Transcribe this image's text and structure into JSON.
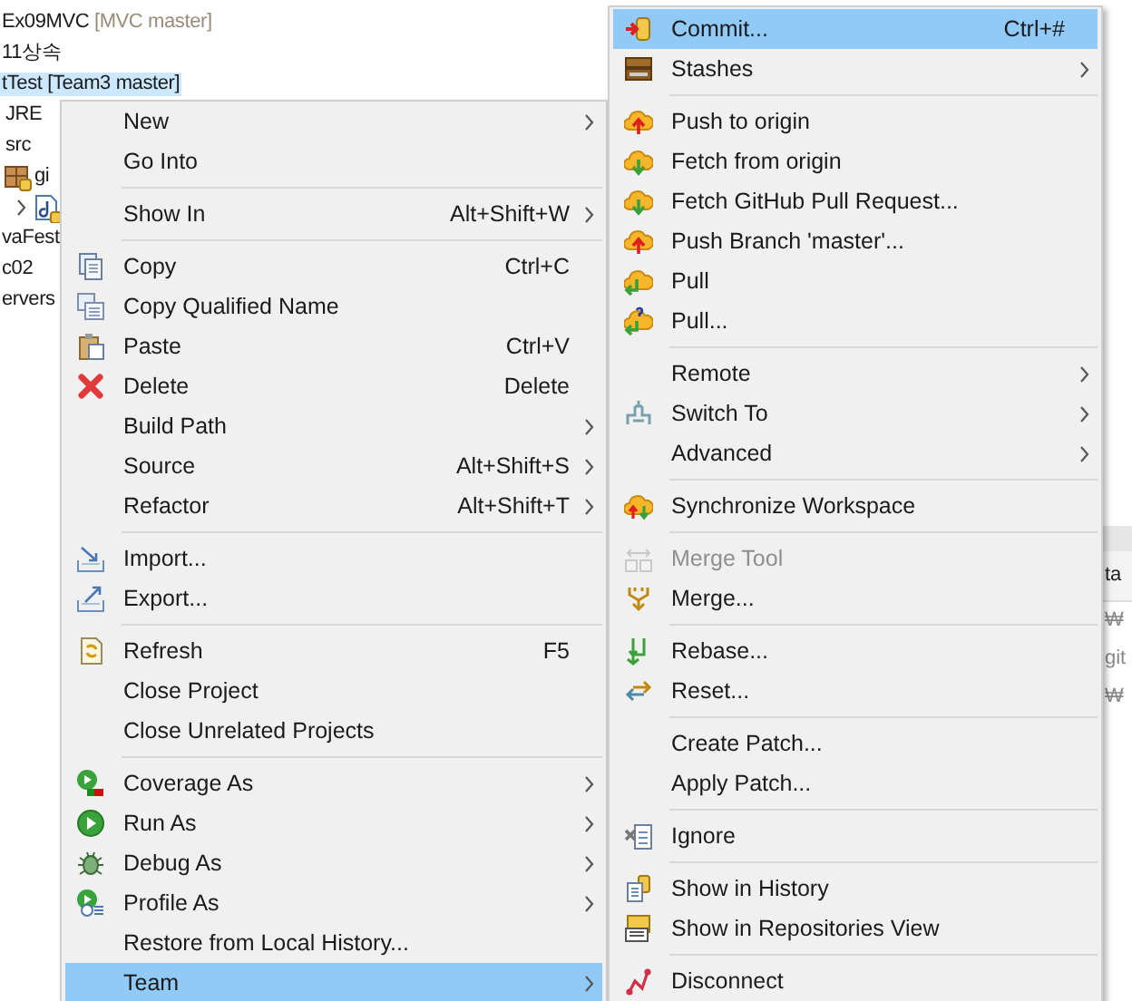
{
  "tree": [
    {
      "label": "Ex09MVC",
      "decoration": "[MVC master]",
      "selected": false,
      "kind": "project"
    },
    {
      "label": "11상속",
      "selected": false,
      "kind": "plain"
    },
    {
      "label": "tTest",
      "decoration": "[Team3 master]",
      "selected": true,
      "kind": "plain"
    },
    {
      "label": "JRE",
      "selected": false,
      "kind": "indented"
    },
    {
      "label": "src",
      "selected": false,
      "kind": "indented"
    },
    {
      "label": "gi",
      "selected": false,
      "kind": "repo"
    },
    {
      "selected": false,
      "kind": "file",
      "expanded": false
    },
    {
      "label": "vaFest",
      "selected": false,
      "kind": "plain"
    },
    {
      "label": "c02",
      "selected": false,
      "kind": "plain"
    },
    {
      "label": "ervers",
      "selected": false,
      "kind": "plain"
    }
  ],
  "panel": {
    "header": "ta",
    "lines": [
      "₩",
      "git",
      "₩"
    ]
  },
  "context_menu": [
    {
      "kind": "item",
      "label": "New",
      "submenu": true,
      "selected": false
    },
    {
      "kind": "item",
      "label": "Go Into",
      "selected": false
    },
    {
      "kind": "separator"
    },
    {
      "kind": "item",
      "label": "Show In",
      "shortcut": "Alt+Shift+W",
      "submenu": true,
      "selected": false
    },
    {
      "kind": "separator"
    },
    {
      "kind": "item",
      "label": "Copy",
      "shortcut": "Ctrl+C",
      "selected": false
    },
    {
      "kind": "item",
      "label": "Copy Qualified Name",
      "selected": false
    },
    {
      "kind": "item",
      "label": "Paste",
      "shortcut": "Ctrl+V",
      "selected": false
    },
    {
      "kind": "item",
      "label": "Delete",
      "shortcut": "Delete",
      "selected": false
    },
    {
      "kind": "item",
      "label": "Build Path",
      "submenu": true,
      "selected": false
    },
    {
      "kind": "item",
      "label": "Source",
      "shortcut": "Alt+Shift+S",
      "submenu": true,
      "selected": false
    },
    {
      "kind": "item",
      "label": "Refactor",
      "shortcut": "Alt+Shift+T",
      "submenu": true,
      "selected": false
    },
    {
      "kind": "separator"
    },
    {
      "kind": "item",
      "label": "Import...",
      "selected": false
    },
    {
      "kind": "item",
      "label": "Export...",
      "selected": false
    },
    {
      "kind": "separator"
    },
    {
      "kind": "item",
      "label": "Refresh",
      "shortcut": "F5",
      "selected": false
    },
    {
      "kind": "item",
      "label": "Close Project",
      "selected": false
    },
    {
      "kind": "item",
      "label": "Close Unrelated Projects",
      "selected": false
    },
    {
      "kind": "separator"
    },
    {
      "kind": "item",
      "label": "Coverage As",
      "submenu": true,
      "selected": false
    },
    {
      "kind": "item",
      "label": "Run As",
      "submenu": true,
      "selected": false
    },
    {
      "kind": "item",
      "label": "Debug As",
      "submenu": true,
      "selected": false
    },
    {
      "kind": "item",
      "label": "Profile As",
      "submenu": true,
      "selected": false
    },
    {
      "kind": "item",
      "label": "Restore from Local History...",
      "selected": false
    },
    {
      "kind": "item",
      "label": "Team",
      "submenu": true,
      "selected": true
    }
  ],
  "team_menu": [
    {
      "kind": "item",
      "label": "Commit...",
      "shortcut": "Ctrl+#",
      "selected": true,
      "disabled": false
    },
    {
      "kind": "item",
      "label": "Stashes",
      "submenu": true,
      "selected": false,
      "disabled": false
    },
    {
      "kind": "separator"
    },
    {
      "kind": "item",
      "label": "Push to origin",
      "selected": false,
      "disabled": false
    },
    {
      "kind": "item",
      "label": "Fetch from origin",
      "selected": false,
      "disabled": false
    },
    {
      "kind": "item",
      "label": "Fetch GitHub Pull Request...",
      "selected": false,
      "disabled": false
    },
    {
      "kind": "item",
      "label": "Push Branch 'master'...",
      "selected": false,
      "disabled": false
    },
    {
      "kind": "item",
      "label": "Pull",
      "selected": false,
      "disabled": false
    },
    {
      "kind": "item",
      "label": "Pull...",
      "selected": false,
      "disabled": false
    },
    {
      "kind": "separator"
    },
    {
      "kind": "item",
      "label": "Remote",
      "submenu": true,
      "selected": false,
      "disabled": false
    },
    {
      "kind": "item",
      "label": "Switch To",
      "submenu": true,
      "selected": false,
      "disabled": false
    },
    {
      "kind": "item",
      "label": "Advanced",
      "submenu": true,
      "selected": false,
      "disabled": false
    },
    {
      "kind": "separator"
    },
    {
      "kind": "item",
      "label": "Synchronize Workspace",
      "selected": false,
      "disabled": false
    },
    {
      "kind": "separator"
    },
    {
      "kind": "item",
      "label": "Merge Tool",
      "selected": false,
      "disabled": true
    },
    {
      "kind": "item",
      "label": "Merge...",
      "selected": false,
      "disabled": false
    },
    {
      "kind": "separator"
    },
    {
      "kind": "item",
      "label": "Rebase...",
      "selected": false,
      "disabled": false
    },
    {
      "kind": "item",
      "label": "Reset...",
      "selected": false,
      "disabled": false
    },
    {
      "kind": "separator"
    },
    {
      "kind": "item",
      "label": "Create Patch...",
      "selected": false,
      "disabled": false
    },
    {
      "kind": "item",
      "label": "Apply Patch...",
      "selected": false,
      "disabled": false
    },
    {
      "kind": "separator"
    },
    {
      "kind": "item",
      "label": "Ignore",
      "selected": false,
      "disabled": false
    },
    {
      "kind": "separator"
    },
    {
      "kind": "item",
      "label": "Show in History",
      "selected": false,
      "disabled": false
    },
    {
      "kind": "item",
      "label": "Show in Repositories View",
      "selected": false,
      "disabled": false
    },
    {
      "kind": "separator"
    },
    {
      "kind": "item",
      "label": "Disconnect",
      "selected": false,
      "disabled": false
    }
  ]
}
